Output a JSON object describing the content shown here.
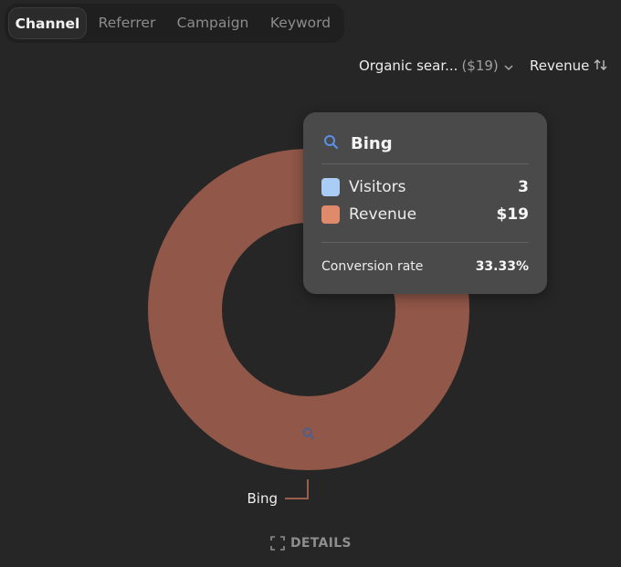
{
  "tabs": [
    {
      "label": "Channel",
      "active": true
    },
    {
      "label": "Referrer",
      "active": false
    },
    {
      "label": "Campaign",
      "active": false
    },
    {
      "label": "Keyword",
      "active": false
    }
  ],
  "filter": {
    "label": "Organic sear...",
    "amount": "($19)",
    "icon": "chevron-down-icon"
  },
  "sort": {
    "label": "Revenue",
    "icon": "sort-arrows-icon"
  },
  "chart_data": {
    "type": "pie",
    "categories": [
      "Bing"
    ],
    "values": [
      19
    ],
    "series": [
      {
        "name": "Revenue",
        "values": [
          19
        ]
      }
    ],
    "color": "#915748",
    "labels": [
      {
        "text": "Bing"
      }
    ]
  },
  "tooltip": {
    "title": "Bing",
    "icon": "search-icon",
    "rows": [
      {
        "label": "Visitors",
        "value": "3",
        "color": "#a9cdf5"
      },
      {
        "label": "Revenue",
        "value": "$19",
        "color": "#e08a6c"
      }
    ],
    "conversion_label": "Conversion rate",
    "conversion_value": "33.33%"
  },
  "footer": {
    "details_label": "DETAILS",
    "icon": "expand-icon"
  }
}
